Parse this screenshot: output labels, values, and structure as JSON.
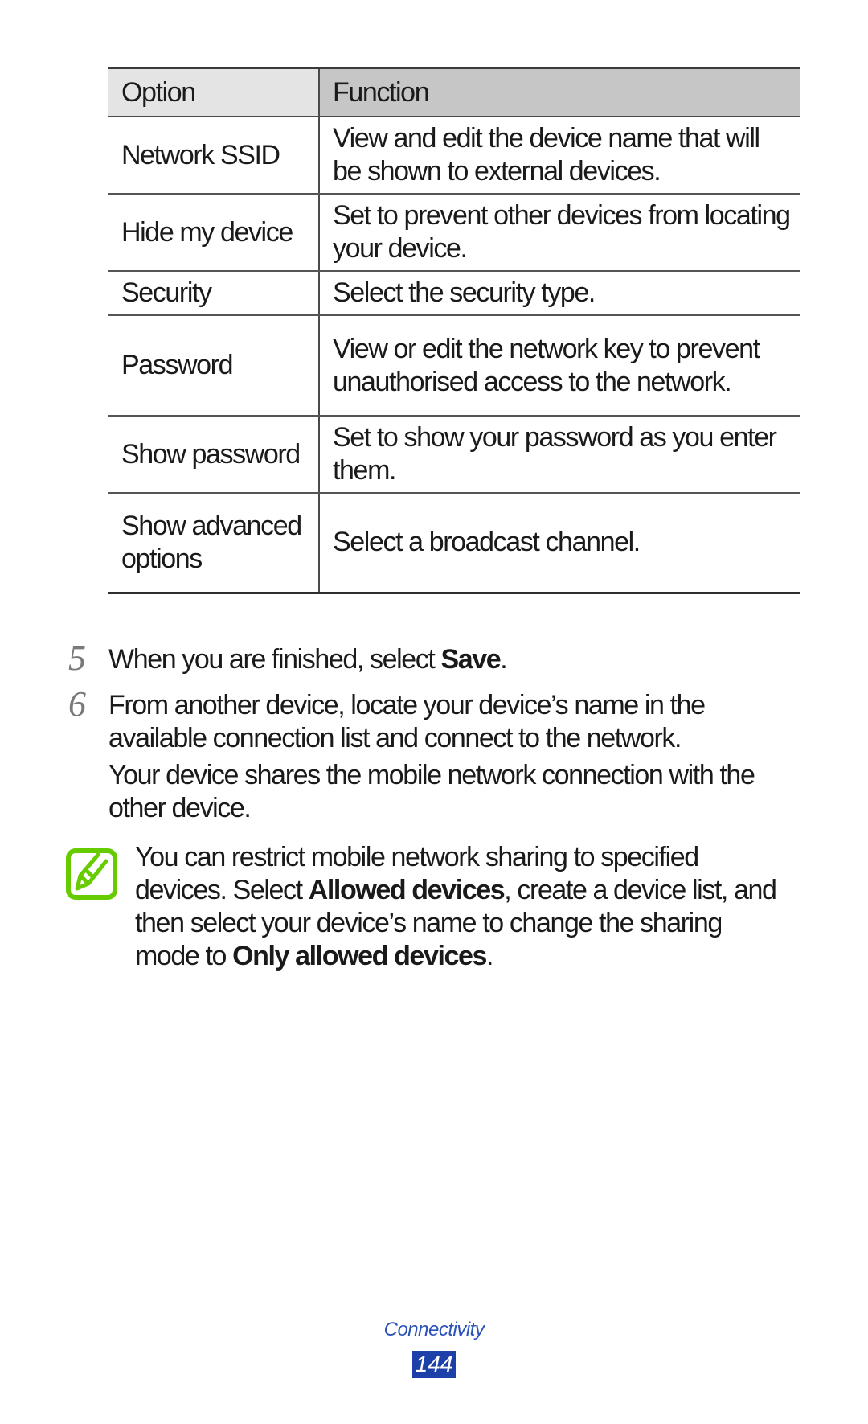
{
  "table": {
    "headers": [
      "Option",
      "Function"
    ],
    "header_colors": [
      "#e4e4e4",
      "#c6c6c6"
    ],
    "rows": [
      {
        "option": "Network SSID",
        "function": "View and edit the device name that will be shown to external devices."
      },
      {
        "option": "Hide my device",
        "function": "Set to prevent other devices from locating your device."
      },
      {
        "option": "Security",
        "function": "Select the security type."
      },
      {
        "option": "Password",
        "function": "View or edit the network key to prevent unauthorised access to the network."
      },
      {
        "option": "Show password",
        "function": "Set to show your password as you enter them."
      },
      {
        "option": "Show advanced options",
        "function": "Select a broadcast channel."
      }
    ]
  },
  "steps": [
    {
      "number": "5",
      "text_before": "When you are finished, select ",
      "bold": "Save",
      "text_after": "."
    },
    {
      "number": "6",
      "text": "From another device, locate your device’s name in the available connection list and connect to the network."
    }
  ],
  "result_paragraph": "Your device shares the mobile network connection with the other device.",
  "note": {
    "icon": "note-pencil-icon",
    "icon_color": "#66cc00",
    "part1": "You can restrict mobile network sharing to specified devices. Select ",
    "bold1": "Allowed devices",
    "part2": ", create a device list, and then select your device’s name to change the sharing mode to ",
    "bold2": "Only allowed devices",
    "part3": "."
  },
  "footer": {
    "section": "Connectivity",
    "page_number": "144",
    "accent_color": "#1c3fa8"
  }
}
